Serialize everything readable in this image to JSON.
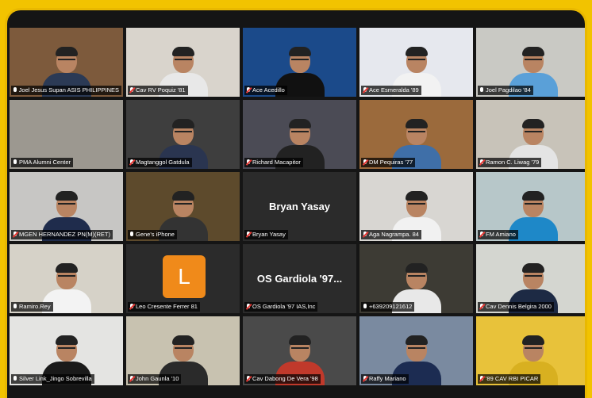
{
  "meeting": {
    "participants": [
      {
        "name": "Joel Jesus Supan ASIS PHILIPPINES",
        "muted": false,
        "bg": "#7d5a3c",
        "suit": "#2b3a55"
      },
      {
        "name": "Cav RV Poquiz '81",
        "muted": true,
        "bg": "#d9d4cc",
        "suit": "#e8e8e8"
      },
      {
        "name": "Ace Acedillo",
        "muted": true,
        "bg": "#1b4a8a",
        "suit": "#111"
      },
      {
        "name": "Ace Esmeralda '89",
        "muted": true,
        "bg": "#e6e8ee",
        "suit": "#f2f2f2"
      },
      {
        "name": "Joel Pagdilao '84",
        "muted": false,
        "bg": "#c9c9c4",
        "suit": "#5aa0d8"
      },
      {
        "name": "PMA Alumni Center",
        "muted": false,
        "bg": "#9c9890",
        "suit": null
      },
      {
        "name": "Magtanggol Gatdula",
        "muted": true,
        "bg": "#3e3e3e",
        "suit": "#2a3550"
      },
      {
        "name": "Richard Macapitor",
        "muted": true,
        "bg": "#4b4b55",
        "suit": "#222"
      },
      {
        "name": "DM Pequiras '77",
        "muted": true,
        "bg": "#9b6a3c",
        "suit": "#3f6fa8"
      },
      {
        "name": "Ramon C. Liwag '79",
        "muted": true,
        "bg": "#c8c3b9",
        "suit": "#e4e4e4"
      },
      {
        "name": "MGEN HERNANDEZ PN(M)(RET)",
        "muted": true,
        "bg": "#c7c6c4",
        "suit": "#1f2c4c"
      },
      {
        "name": "Gene's iPhone",
        "muted": false,
        "bg": "#5d4a2c",
        "suit": "#333"
      },
      {
        "name": "Bryan Yasay",
        "muted": true,
        "bg": "#2b2b2b",
        "suit": null,
        "display": "Bryan Yasay"
      },
      {
        "name": "Aga Nagrampa. 84",
        "muted": true,
        "bg": "#d8d6d2",
        "suit": "#f1f1f1"
      },
      {
        "name": "FM Amiano",
        "muted": true,
        "bg": "#b7c7c9",
        "suit": "#1e88c8"
      },
      {
        "name": "Ramiro.Rey",
        "muted": false,
        "bg": "#d6d2c8",
        "suit": "#f3f3f3"
      },
      {
        "name": "Leo Cresente Ferrer 81",
        "muted": true,
        "bg": "#2b2b2b",
        "suit": null,
        "letter": "L"
      },
      {
        "name": "OS Gardiola '97 IAS,Inc",
        "muted": true,
        "bg": "#2b2b2b",
        "suit": null,
        "display": "OS Gardiola '97..."
      },
      {
        "name": "+639209121612",
        "muted": false,
        "bg": "#3d3b34",
        "suit": "#e8e8e8",
        "active": true
      },
      {
        "name": "Cav Dennis Belgira 2000",
        "muted": true,
        "bg": "#d4d6d0",
        "suit": "#1d2a44"
      },
      {
        "name": "Silver Link_Jingo Sobrevilla",
        "muted": false,
        "bg": "#e4e4e2",
        "suit": "#1a1a1a"
      },
      {
        "name": "John Gaunla '10",
        "muted": true,
        "bg": "#c8c2b0",
        "suit": "#2a2a2a"
      },
      {
        "name": "Cav Dabong De Vera '98",
        "muted": true,
        "bg": "#4a4a4a",
        "suit": "#c0392b"
      },
      {
        "name": "Raffy Mariano",
        "muted": true,
        "bg": "#7a8aa0",
        "suit": "#1c2c52"
      },
      {
        "name": "'89 CAV RBI PICAR",
        "muted": true,
        "bg": "#e8c23a",
        "suit": "#d8b020"
      }
    ]
  }
}
